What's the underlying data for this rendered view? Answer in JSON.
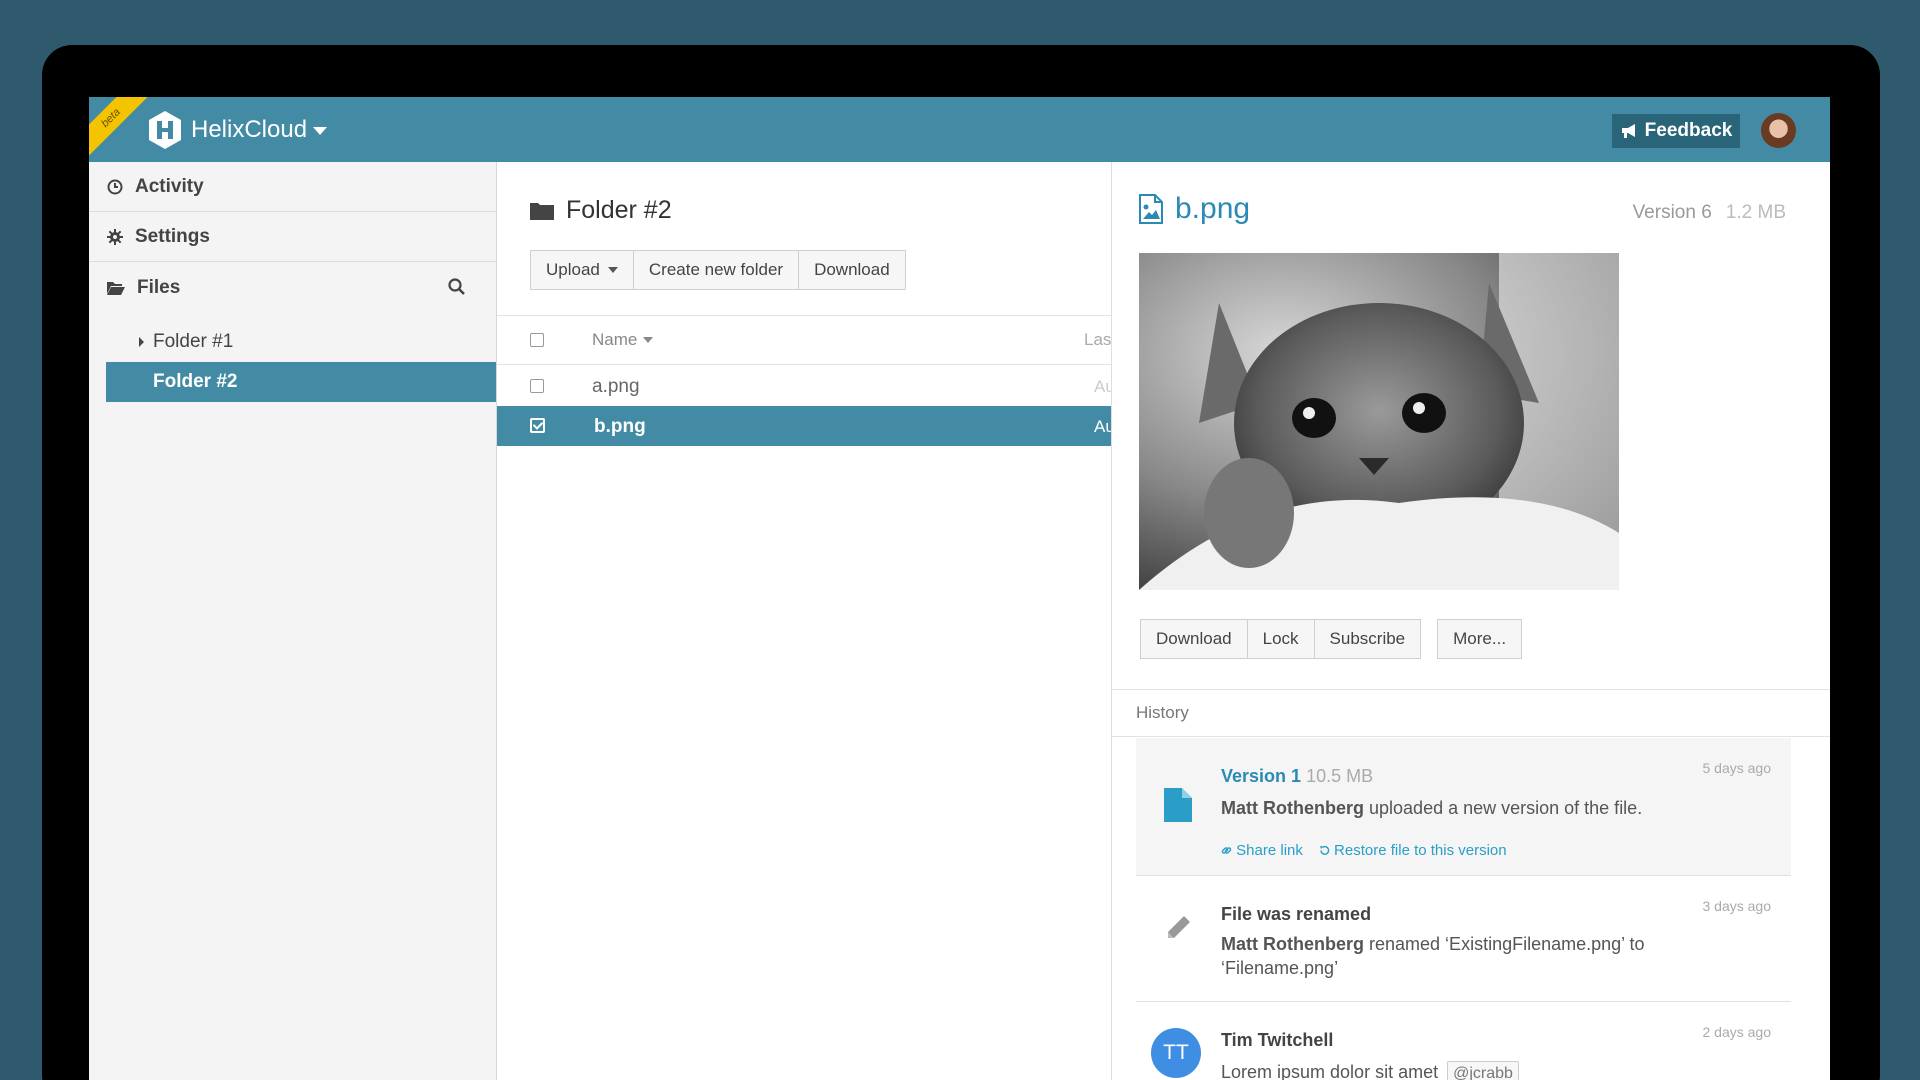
{
  "app": {
    "beta_label": "beta",
    "brand_name": "HelixCloud",
    "feedback_label": "Feedback"
  },
  "sidebar": {
    "items": [
      {
        "label": "Activity",
        "icon": "clock-icon"
      },
      {
        "label": "Settings",
        "icon": "gear-icon"
      },
      {
        "label": "Files",
        "icon": "folder-open-icon"
      }
    ],
    "tree": [
      {
        "label": "Folder #1",
        "selected": false
      },
      {
        "label": "Folder #2",
        "selected": true
      }
    ]
  },
  "folder": {
    "title": "Folder #2",
    "buttons": {
      "upload": "Upload",
      "create_folder": "Create new folder",
      "download": "Download"
    },
    "columns": {
      "name": "Name",
      "last": "Last"
    },
    "files": [
      {
        "name": "a.png",
        "date": "Au",
        "checked": false
      },
      {
        "name": "b.png",
        "date": "Au",
        "checked": true
      }
    ]
  },
  "detail": {
    "file_name": "b.png",
    "version": "Version 6",
    "size": "1.2 MB",
    "buttons": {
      "download": "Download",
      "lock": "Lock",
      "subscribe": "Subscribe",
      "more": "More..."
    },
    "history_label": "History",
    "history": [
      {
        "title": "Version 1",
        "size": "10.5 MB",
        "ago": "5 days ago",
        "user": "Matt Rothenberg",
        "text": "uploaded a new version of the file.",
        "link_share": "Share link",
        "link_restore": "Restore file to this version"
      },
      {
        "title": "File was renamed",
        "ago": "3 days ago",
        "user": "Matt Rothenberg",
        "text": "renamed ‘ExistingFilename.png’ to ‘Filename.png’"
      },
      {
        "title": "Tim Twitchell",
        "ago": "2 days ago",
        "initials": "TT",
        "text": "Lorem ipsum dolor sit amet",
        "mention": "@jcrabb"
      }
    ]
  },
  "colors": {
    "background": "#2f5a6d",
    "accent": "#438ba5",
    "link": "#2a8ab5",
    "beta": "#f5c400"
  }
}
